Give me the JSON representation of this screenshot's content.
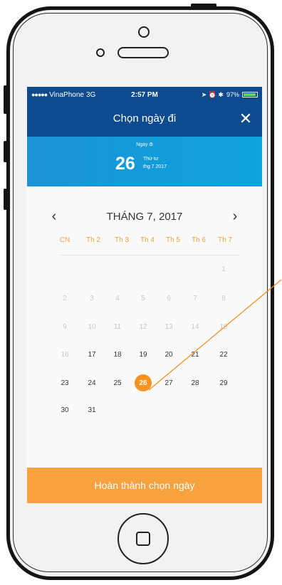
{
  "status_bar": {
    "signal_dots": "●●●●●",
    "carrier": "VinaPhone",
    "network": "3G",
    "time": "2:57 PM",
    "icons": "➤ ⏰ ✱",
    "battery_text": "97%",
    "battery_level": 0.97
  },
  "navbar": {
    "title": "Chọn ngày đi",
    "close_icon": "✕"
  },
  "banner": {
    "label": "Ngày đi",
    "day": "26",
    "weekday": "Thứ tư",
    "month_year": "thg 7 2017"
  },
  "calendar": {
    "prev_icon": "‹",
    "next_icon": "›",
    "month_title": "THÁNG 7, 2017",
    "weekdays": [
      "CN",
      "Th 2",
      "Th 3",
      "Th 4",
      "Th 5",
      "Th 6",
      "Th 7"
    ],
    "weekday_color": "#f5a03a",
    "weeks": [
      [
        "",
        "",
        "",
        "",
        "",
        "",
        "1"
      ],
      [
        "2",
        "3",
        "4",
        "5",
        "6",
        "7",
        "8"
      ],
      [
        "9",
        "10",
        "11",
        "12",
        "13",
        "14",
        "15"
      ],
      [
        "16",
        "17",
        "18",
        "19",
        "20",
        "21",
        "22"
      ],
      [
        "23",
        "24",
        "25",
        "26",
        "27",
        "28",
        "29"
      ],
      [
        "30",
        "31",
        "",
        "",
        "",
        "",
        ""
      ]
    ],
    "disabled_days": [
      "1",
      "2",
      "3",
      "4",
      "5",
      "6",
      "7",
      "8",
      "9",
      "10",
      "11",
      "12",
      "13",
      "14",
      "15",
      "16"
    ],
    "selected_day": "26",
    "selected_color": "#f7931e"
  },
  "footer": {
    "complete_label": "Hoàn thành chọn ngày",
    "color": "#f7a23c"
  }
}
